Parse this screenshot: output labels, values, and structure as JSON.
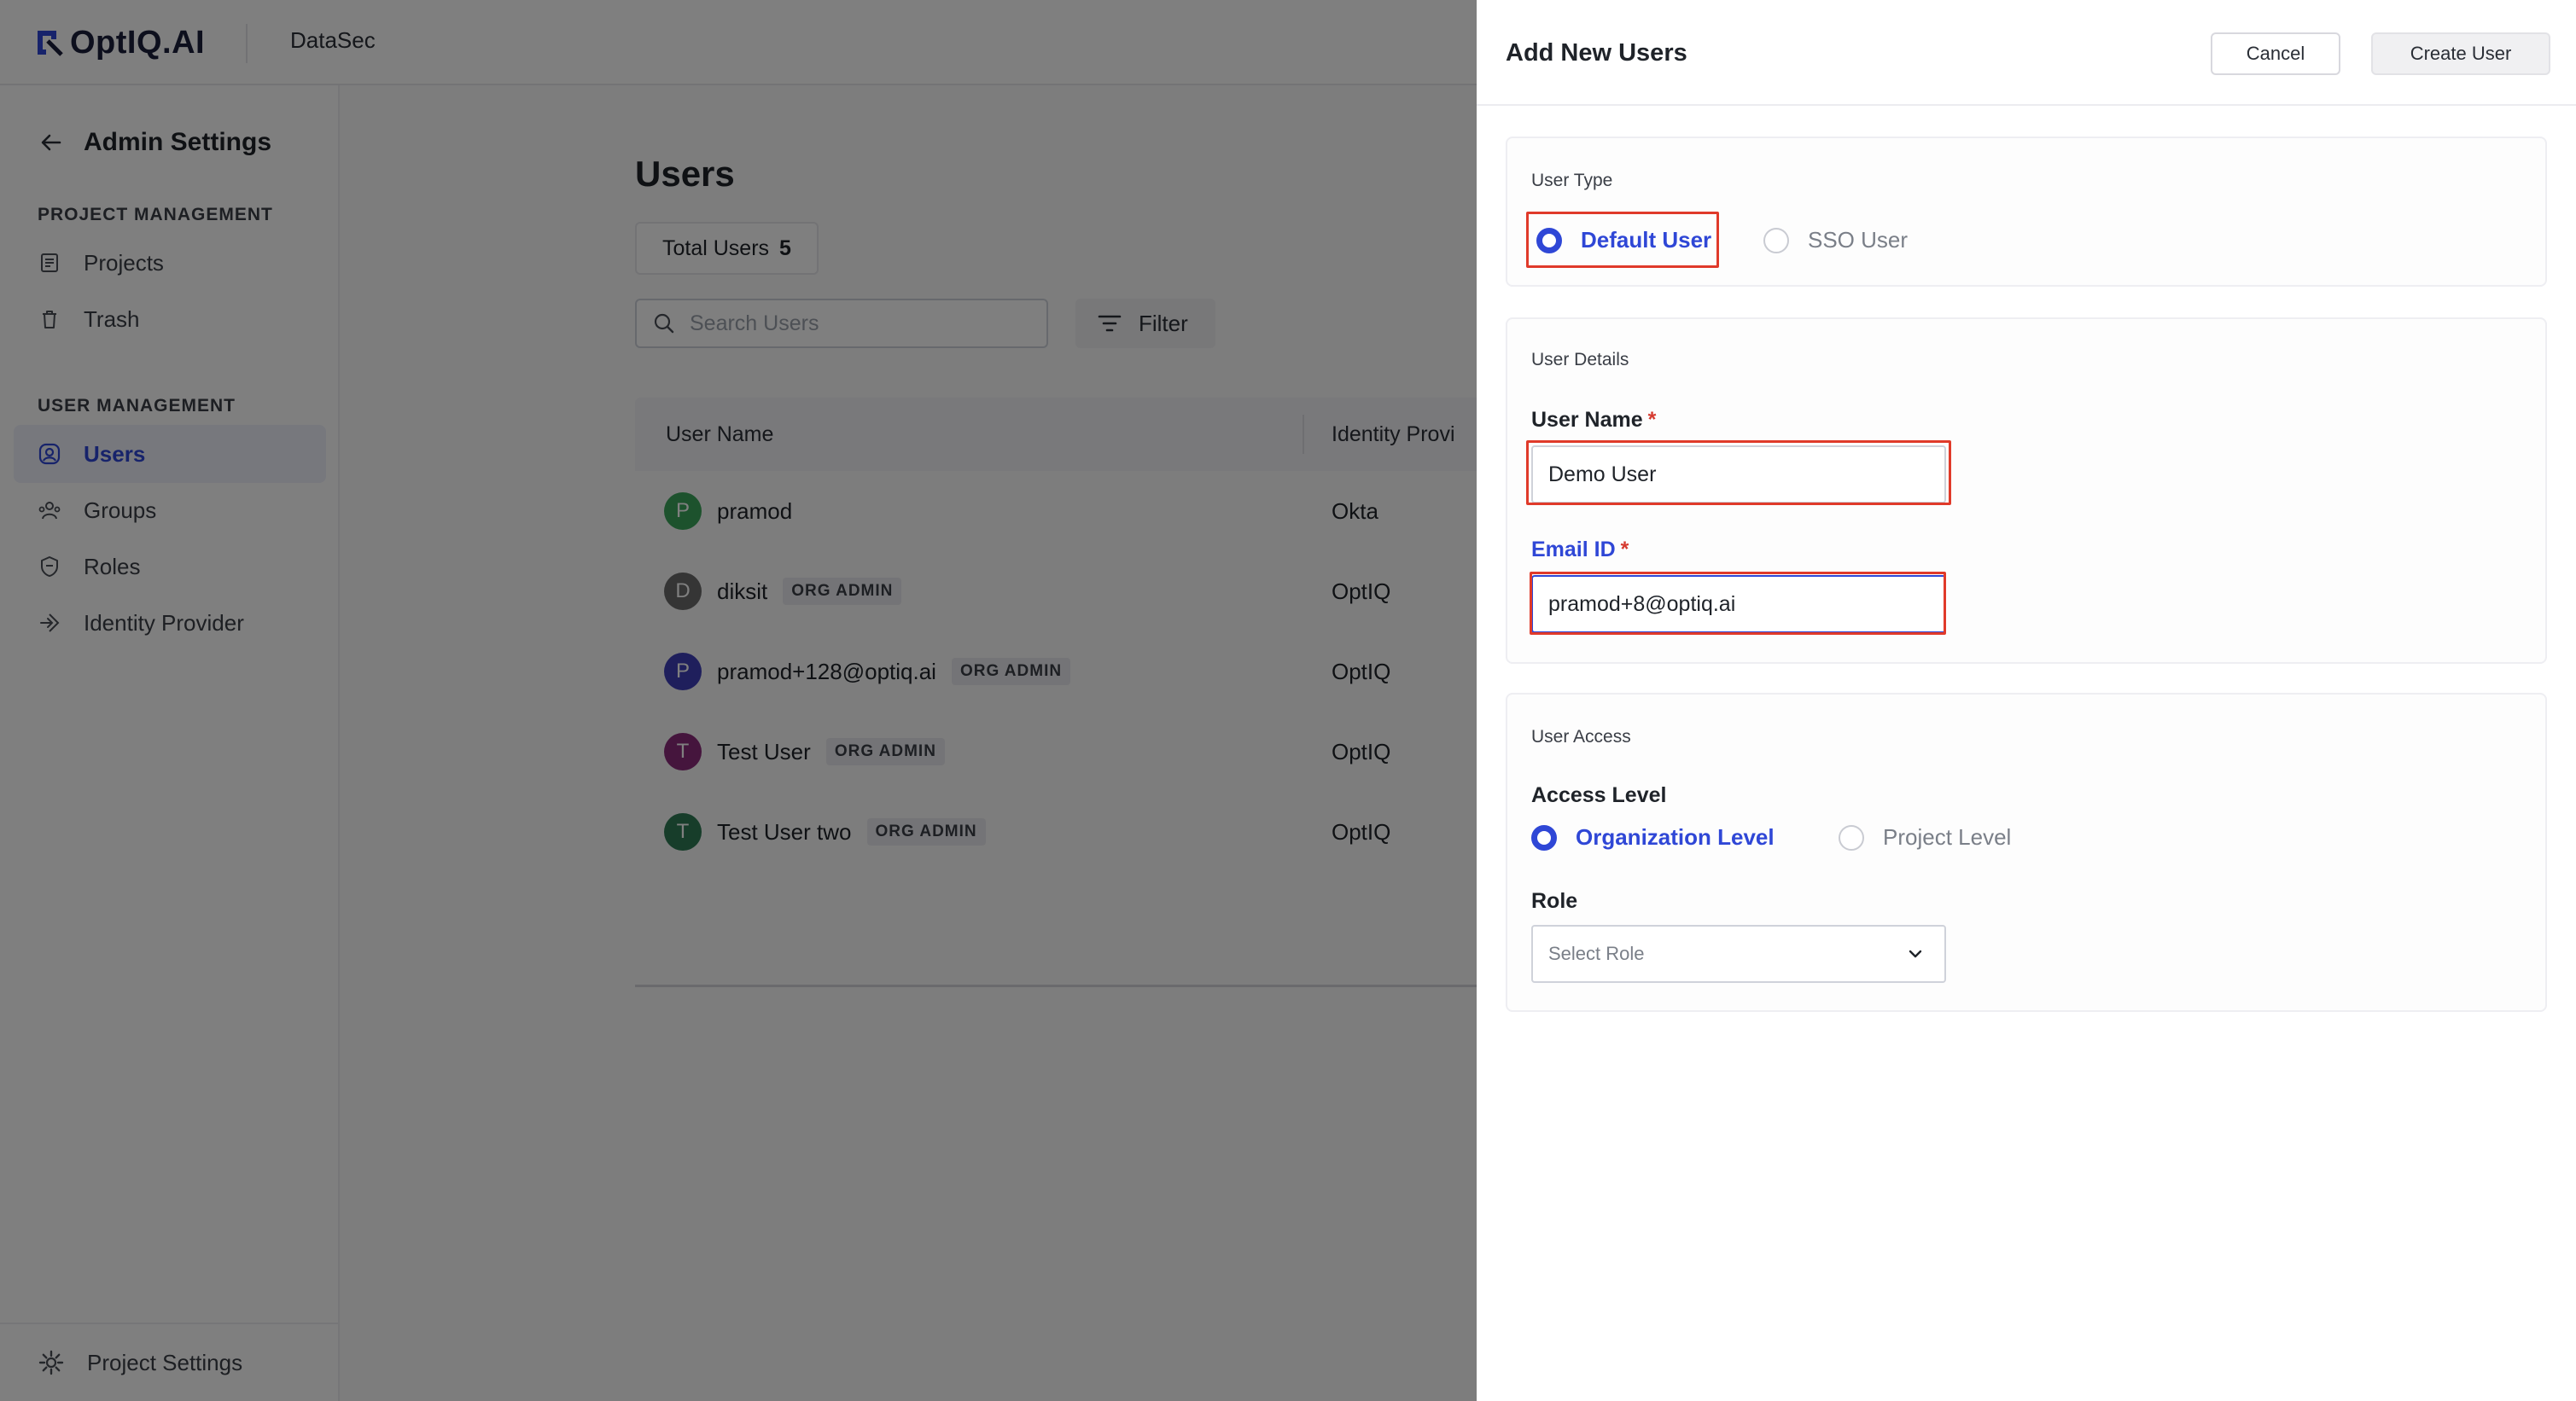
{
  "app": {
    "logo_text": "OptIQ.AI",
    "workspace": "DataSec",
    "accent_color": "#2f47d6"
  },
  "sidebar": {
    "title": "Admin Settings",
    "sections": [
      {
        "heading": "PROJECT MANAGEMENT"
      },
      {
        "heading": "USER MANAGEMENT"
      }
    ],
    "items": [
      {
        "label": "Projects",
        "icon": "document-icon"
      },
      {
        "label": "Trash",
        "icon": "trash-icon"
      },
      {
        "label": "Users",
        "icon": "user-circle-icon",
        "active": true
      },
      {
        "label": "Groups",
        "icon": "groups-icon"
      },
      {
        "label": "Roles",
        "icon": "shield-icon"
      },
      {
        "label": "Identity Provider",
        "icon": "login-arrow-icon"
      }
    ],
    "footer": {
      "label": "Project Settings",
      "icon": "gear-icon"
    }
  },
  "main": {
    "title": "Users",
    "total_label": "Total Users",
    "total_count": "5",
    "search_placeholder": "Search Users",
    "filter_label": "Filter",
    "columns": [
      "User Name",
      "Identity Provi"
    ],
    "rows": [
      {
        "initial": "P",
        "name": "pramod",
        "badge": "",
        "idp": "Okta",
        "avatar_color": "#3aa55a"
      },
      {
        "initial": "D",
        "name": "diksit",
        "badge": "ORG ADMIN",
        "idp": "OptIQ",
        "avatar_color": "#6b6b6b"
      },
      {
        "initial": "P",
        "name": "pramod+128@optiq.ai",
        "badge": "ORG ADMIN",
        "idp": "OptIQ",
        "avatar_color": "#3f3fb8"
      },
      {
        "initial": "T",
        "name": "Test User",
        "badge": "ORG ADMIN",
        "idp": "OptIQ",
        "avatar_color": "#8a2a7a"
      },
      {
        "initial": "T",
        "name": "Test User two",
        "badge": "ORG ADMIN",
        "idp": "OptIQ",
        "avatar_color": "#2e7a55"
      }
    ]
  },
  "drawer": {
    "title": "Add New Users",
    "cancel_label": "Cancel",
    "create_label": "Create User",
    "user_type": {
      "label": "User Type",
      "options": [
        "Default User",
        "SSO User"
      ],
      "selected": "Default User"
    },
    "user_details": {
      "label": "User Details",
      "name_label": "User Name",
      "name_value": "Demo User",
      "email_label": "Email ID",
      "email_value": "pramod+8@optiq.ai",
      "required_mark": "*"
    },
    "user_access": {
      "label": "User Access",
      "access_label": "Access Level",
      "options": [
        "Organization Level",
        "Project Level"
      ],
      "selected": "Organization Level",
      "role_label": "Role",
      "role_placeholder": "Select Role"
    }
  }
}
